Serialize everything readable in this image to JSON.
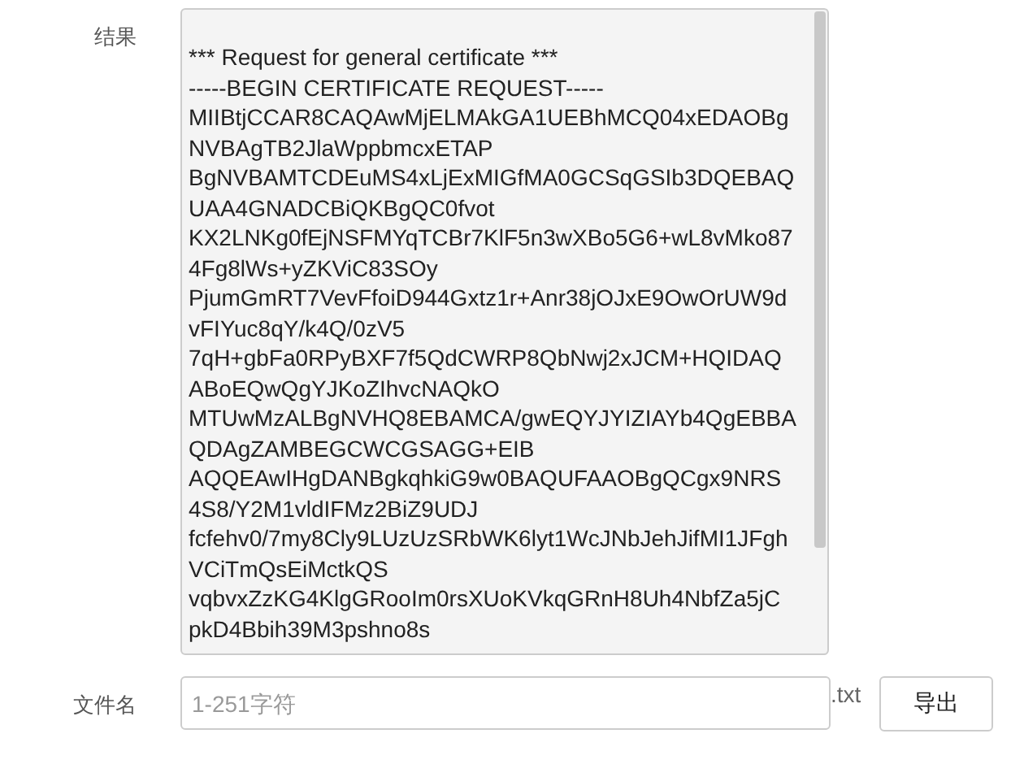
{
  "result": {
    "label": "结果",
    "lines": [
      "*** Request for general certificate ***",
      "-----BEGIN CERTIFICATE REQUEST-----",
      "MIIBtjCCAR8CAQAwMjELMAkGA1UEBhMCQ04xEDAOBg",
      "NVBAgTB2JlaWppbmcxETAP",
      "BgNVBAMTCDEuMS4xLjExMIGfMA0GCSqGSIb3DQEBAQ",
      "UAA4GNADCBiQKBgQC0fvot",
      "KX2LNKg0fEjNSFMYqTCBr7KlF5n3wXBo5G6+wL8vMko87",
      "4Fg8lWs+yZKViC83SOy",
      "PjumGmRT7VevFfoiD944Gxtz1r+Anr38jOJxE9OwOrUW9d",
      "vFIYuc8qY/k4Q/0zV5",
      "7qH+gbFa0RPyBXF7f5QdCWRP8QbNwj2xJCM+HQIDAQ",
      "ABoEQwQgYJKoZIhvcNAQkO",
      "MTUwMzALBgNVHQ8EBAMCA/gwEQYJYIZIAYb4QgEBBA",
      "QDAgZAMBEGCWCGSAGG+EIB",
      "AQQEAwIHgDANBgkqhkiG9w0BAQUFAAOBgQCgx9NRS",
      "4S8/Y2M1vldIFMz2BiZ9UDJ",
      "fcfehv0/7my8Cly9LUzUzSRbWK6lyt1WcJNbJehJifMI1JFgh",
      "VCiTmQsEiMctkQS",
      "vqbvxZzKG4KlgGRooIm0rsXUoKVkqGRnH8Uh4NbfZa5jC",
      "pkD4Bbih39M3pshno8s"
    ]
  },
  "filename": {
    "label": "文件名",
    "placeholder": "1-251字符",
    "suffix": ".txt"
  },
  "export_button": "导出"
}
